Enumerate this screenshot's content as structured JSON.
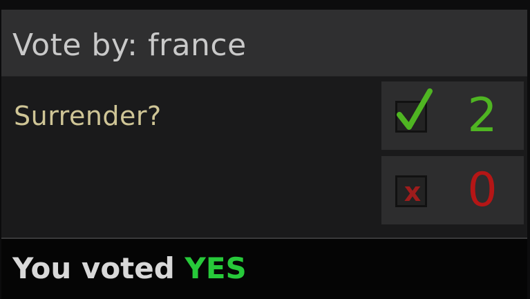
{
  "header": {
    "title": "Vote by: france"
  },
  "vote": {
    "question": "Surrender?",
    "yes": {
      "icon": "check-icon",
      "count": "2",
      "color": "#4fb522"
    },
    "no": {
      "icon": "x-icon",
      "symbol": "x",
      "count": "0",
      "color": "#b41616"
    }
  },
  "footer": {
    "prefix": "You voted ",
    "choice": "YES",
    "choice_color": "#27c93a"
  }
}
